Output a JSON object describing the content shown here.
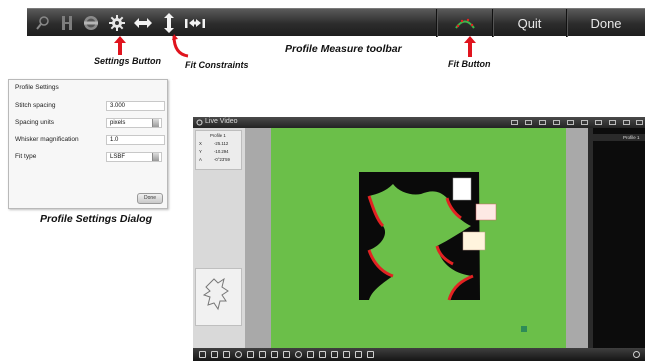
{
  "toolbar": {
    "quit_label": "Quit",
    "done_label": "Done",
    "icons": [
      "search-icon",
      "measure-icon",
      "circle-icon",
      "settings-icon",
      "horizontal-fit-icon",
      "vertical-fit-icon",
      "profile-fit-icon",
      "fit-icon"
    ]
  },
  "annotations": {
    "toolbar_caption": "Profile Measure toolbar",
    "settings_button": "Settings Button",
    "fit_constraints": "Fit Constraints",
    "fit_button": "Fit Button",
    "dialog_caption": "Profile Settings Dialog"
  },
  "dialog": {
    "title": "Profile Settings",
    "rows": [
      {
        "label": "Stitch spacing",
        "value": "3.000"
      },
      {
        "label": "Spacing units",
        "value": "pixels"
      },
      {
        "label": "Whisker magnification",
        "value": "1.0"
      },
      {
        "label": "Fit type",
        "value": "LSBF"
      }
    ],
    "done_label": "Done"
  },
  "video": {
    "title": "Live Video",
    "info": {
      "heading": "Profile 1",
      "rows": [
        {
          "label": "X",
          "value": "-25.112"
        },
        {
          "label": "Y",
          "value": "-10.294"
        },
        {
          "label": "A",
          "value": "-0°23'59"
        }
      ]
    },
    "right_item": "Profile 1"
  },
  "colors": {
    "accent_red": "#e0141e",
    "video_green": "#6bbf49",
    "fit_green": "#3fb54a",
    "profile_red": "#e22222"
  }
}
